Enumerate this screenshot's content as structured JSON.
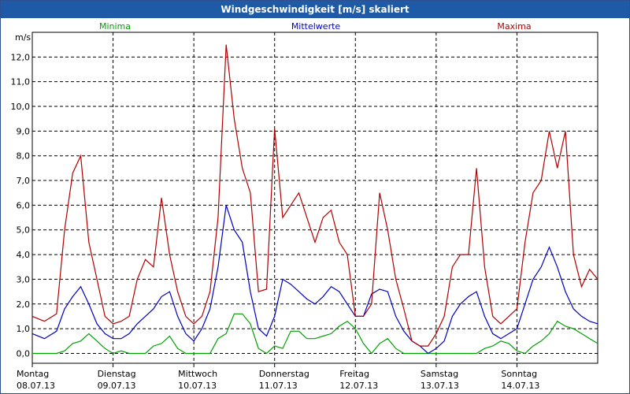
{
  "window": {
    "title": "Windgeschwindigkeit [m/s] skaliert"
  },
  "chart_data": {
    "type": "line",
    "title": "Windgeschwindigkeit [m/s] skaliert",
    "ylabel": "m/s",
    "ylim": [
      -0.4,
      13
    ],
    "yticks": [
      "0,0",
      "1,0",
      "2,0",
      "3,0",
      "4,0",
      "5,0",
      "6,0",
      "7,0",
      "8,0",
      "9,0",
      "10,0",
      "11,0",
      "12,0"
    ],
    "xlim": [
      0,
      7
    ],
    "x_labels": [
      {
        "day": "Montag",
        "date": "08.07.13"
      },
      {
        "day": "Dienstag",
        "date": "09.07.13"
      },
      {
        "day": "Mittwoch",
        "date": "10.07.13"
      },
      {
        "day": "Donnerstag",
        "date": "11.07.13"
      },
      {
        "day": "Freitag",
        "date": "12.07.13"
      },
      {
        "day": "Samstag",
        "date": "13.07.13"
      },
      {
        "day": "Sonntag",
        "date": "14.07.13"
      }
    ],
    "grid": true,
    "legend_position": "top",
    "series": [
      {
        "name": "Minima",
        "color": "#00a000",
        "x": [
          0,
          0.15,
          0.3,
          0.4,
          0.5,
          0.6,
          0.7,
          0.8,
          0.9,
          1.0,
          1.1,
          1.2,
          1.3,
          1.4,
          1.5,
          1.6,
          1.7,
          1.8,
          1.9,
          2.0,
          2.1,
          2.2,
          2.3,
          2.4,
          2.5,
          2.6,
          2.7,
          2.8,
          2.9,
          3.0,
          3.1,
          3.2,
          3.3,
          3.4,
          3.5,
          3.6,
          3.7,
          3.8,
          3.9,
          4.0,
          4.1,
          4.2,
          4.3,
          4.4,
          4.5,
          4.6,
          4.7,
          4.8,
          4.9,
          5.0,
          5.1,
          5.2,
          5.3,
          5.4,
          5.5,
          5.6,
          5.7,
          5.8,
          5.9,
          6.0,
          6.1,
          6.2,
          6.3,
          6.4,
          6.5,
          6.6,
          6.7,
          6.8,
          6.9,
          7.0
        ],
        "values": [
          0,
          0,
          0,
          0.1,
          0.4,
          0.5,
          0.8,
          0.5,
          0.2,
          0,
          0.1,
          0,
          0,
          0,
          0.3,
          0.4,
          0.7,
          0.2,
          0,
          0,
          0,
          0,
          0.6,
          0.8,
          1.6,
          1.6,
          1.2,
          0.2,
          0,
          0.3,
          0.2,
          0.9,
          0.9,
          0.6,
          0.6,
          0.7,
          0.8,
          1.1,
          1.3,
          1.0,
          0.4,
          0,
          0.4,
          0.6,
          0.2,
          0,
          0,
          0,
          0,
          0,
          0,
          0,
          0,
          0,
          0,
          0.2,
          0.3,
          0.5,
          0.4,
          0.1,
          0,
          0.3,
          0.5,
          0.8,
          1.3,
          1.1,
          1.0,
          0.8,
          0.6,
          0.4
        ]
      },
      {
        "name": "Mittelwerte",
        "color": "#0000c0",
        "x": [
          0,
          0.15,
          0.3,
          0.4,
          0.5,
          0.6,
          0.7,
          0.8,
          0.9,
          1.0,
          1.1,
          1.2,
          1.3,
          1.4,
          1.5,
          1.6,
          1.7,
          1.8,
          1.9,
          2.0,
          2.1,
          2.2,
          2.3,
          2.4,
          2.5,
          2.6,
          2.7,
          2.8,
          2.9,
          3.0,
          3.1,
          3.2,
          3.3,
          3.4,
          3.5,
          3.6,
          3.7,
          3.8,
          3.9,
          4.0,
          4.1,
          4.2,
          4.3,
          4.4,
          4.5,
          4.6,
          4.7,
          4.8,
          4.9,
          5.0,
          5.1,
          5.2,
          5.3,
          5.4,
          5.5,
          5.6,
          5.7,
          5.8,
          5.9,
          6.0,
          6.1,
          6.2,
          6.3,
          6.4,
          6.5,
          6.6,
          6.7,
          6.8,
          6.9,
          7.0
        ],
        "values": [
          0.8,
          0.6,
          0.9,
          1.8,
          2.3,
          2.7,
          2.0,
          1.2,
          0.8,
          0.6,
          0.6,
          0.8,
          1.2,
          1.5,
          1.8,
          2.3,
          2.5,
          1.5,
          0.8,
          0.5,
          1.0,
          1.8,
          3.5,
          6.0,
          5.0,
          4.5,
          2.5,
          1.0,
          0.7,
          1.5,
          3.0,
          2.8,
          2.5,
          2.2,
          2.0,
          2.3,
          2.7,
          2.5,
          2.0,
          1.5,
          1.5,
          2.4,
          2.6,
          2.5,
          1.5,
          0.9,
          0.5,
          0.3,
          0.0,
          0.2,
          0.5,
          1.5,
          2.0,
          2.3,
          2.5,
          1.5,
          0.8,
          0.6,
          0.8,
          1.0,
          2.0,
          3.0,
          3.5,
          4.3,
          3.5,
          2.5,
          1.8,
          1.5,
          1.3,
          1.2
        ]
      },
      {
        "name": "Maxima",
        "color": "#b00000",
        "x": [
          0,
          0.15,
          0.3,
          0.4,
          0.5,
          0.6,
          0.7,
          0.8,
          0.9,
          1.0,
          1.1,
          1.2,
          1.3,
          1.4,
          1.5,
          1.6,
          1.7,
          1.8,
          1.9,
          2.0,
          2.1,
          2.2,
          2.3,
          2.4,
          2.5,
          2.6,
          2.7,
          2.8,
          2.9,
          3.0,
          3.1,
          3.2,
          3.3,
          3.4,
          3.5,
          3.6,
          3.7,
          3.8,
          3.9,
          4.0,
          4.1,
          4.2,
          4.3,
          4.4,
          4.5,
          4.6,
          4.7,
          4.8,
          4.9,
          5.0,
          5.1,
          5.2,
          5.3,
          5.4,
          5.5,
          5.6,
          5.7,
          5.8,
          5.9,
          6.0,
          6.1,
          6.2,
          6.3,
          6.4,
          6.5,
          6.6,
          6.7,
          6.8,
          6.9,
          7.0
        ],
        "values": [
          1.5,
          1.3,
          1.6,
          5.0,
          7.3,
          8.0,
          4.5,
          3.0,
          1.5,
          1.2,
          1.3,
          1.5,
          3.0,
          3.8,
          3.5,
          6.3,
          4.0,
          2.5,
          1.5,
          1.2,
          1.5,
          2.5,
          5.5,
          12.5,
          9.5,
          7.5,
          6.5,
          2.5,
          2.6,
          9.1,
          5.5,
          6.0,
          6.5,
          5.5,
          4.5,
          5.5,
          5.8,
          4.5,
          4.0,
          1.5,
          1.5,
          2.0,
          6.5,
          5.0,
          3.0,
          1.8,
          0.5,
          0.3,
          0.3,
          0.8,
          1.5,
          3.5,
          4.0,
          4.0,
          7.5,
          3.5,
          1.5,
          1.2,
          1.5,
          1.8,
          4.5,
          6.5,
          7.0,
          9.0,
          7.5,
          9.0,
          4.0,
          2.7,
          3.4,
          3.0
        ]
      }
    ]
  }
}
